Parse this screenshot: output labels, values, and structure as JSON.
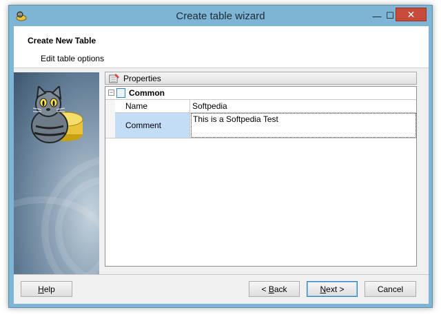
{
  "window": {
    "title": "Create table wizard",
    "minimize_glyph": "—",
    "maximize_glyph": "☐",
    "close_glyph": "✕"
  },
  "header": {
    "title": "Create New Table",
    "subtitle": "Edit table options"
  },
  "properties": {
    "panel_label": "Properties",
    "category": "Common",
    "expander_glyph": "−",
    "rows": [
      {
        "key": "Name",
        "value": "Softpedia"
      },
      {
        "key": "Comment",
        "value": "This is a Softpedia Test"
      }
    ]
  },
  "buttons": {
    "help": {
      "mnemonic": "H",
      "rest": "elp"
    },
    "back": {
      "prefix": "< ",
      "mnemonic": "B",
      "rest": "ack"
    },
    "next": {
      "mnemonic": "N",
      "rest": "ext >"
    },
    "cancel": "Cancel"
  },
  "icons": {
    "app": "database-cat-icon",
    "properties": "properties-icon",
    "category": "category-icon"
  },
  "colors": {
    "titlebar": "#7fb5d4",
    "close_button": "#c74b3b",
    "selected_key": "#c4ddf7"
  }
}
